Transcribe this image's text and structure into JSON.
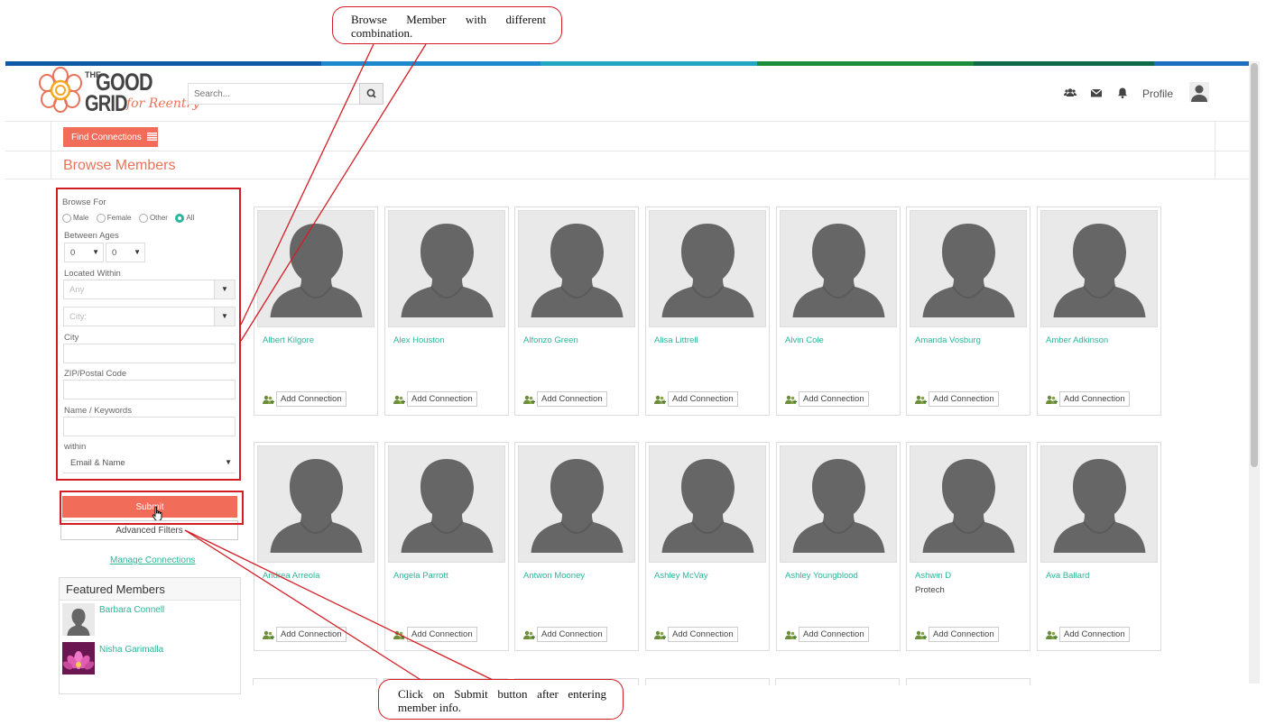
{
  "colors": {
    "accent": "#f26c5a",
    "link": "#2bb59a",
    "annotation": "#d31d25",
    "stripe": [
      "#0f5aa7",
      "#1e88cf",
      "#20a7c1",
      "#1a8d3b",
      "#0f6a4a",
      "#1e6fbf"
    ]
  },
  "header": {
    "logo": {
      "the": "THE",
      "good": "GOOD",
      "grid": "GRID",
      "tagline": "for Reentry"
    },
    "search_placeholder": "Search...",
    "icons": [
      "users-icon",
      "envelope-icon",
      "bell-icon"
    ],
    "profile_label": "Profile"
  },
  "toolbar": {
    "find_connections": "Find Connections"
  },
  "page_title": "Browse Members",
  "filters": {
    "browse_for_label": "Browse For",
    "gender_options": [
      {
        "label": "Male",
        "selected": false
      },
      {
        "label": "Female",
        "selected": false
      },
      {
        "label": "Other",
        "selected": false
      },
      {
        "label": "All",
        "selected": true
      }
    ],
    "between_ages_label": "Between Ages",
    "age_min": "0",
    "age_max": "0",
    "located_within_label": "Located Within",
    "located_value": "Any",
    "city_select_placeholder": "City:",
    "city_label": "City",
    "zip_label": "ZIP/Postal Code",
    "name_keywords_label": "Name / Keywords",
    "within_label": "within",
    "within_value": "Email & Name",
    "submit_label": "Submit",
    "advanced_label": "Advanced Filters",
    "manage_label": "Manage Connections"
  },
  "featured": {
    "title": "Featured Members",
    "members": [
      {
        "name": "Barbara Connell",
        "photo": "silhouette"
      },
      {
        "name": "Nisha Garimalla",
        "photo": "lotus-flower"
      }
    ]
  },
  "members": [
    {
      "name": "Albert Kilgore",
      "subtitle": ""
    },
    {
      "name": "Alex Houston",
      "subtitle": ""
    },
    {
      "name": "Alfonzo Green",
      "subtitle": ""
    },
    {
      "name": "Alisa Littrell",
      "subtitle": ""
    },
    {
      "name": "Alvin Cole",
      "subtitle": ""
    },
    {
      "name": "Amanda Vosburg",
      "subtitle": ""
    },
    {
      "name": "Amber Adkinson",
      "subtitle": ""
    },
    {
      "name": "Andrea Arreola",
      "subtitle": ""
    },
    {
      "name": "Angela Parrott",
      "subtitle": ""
    },
    {
      "name": "Antwon Mooney",
      "subtitle": ""
    },
    {
      "name": "Ashley McVay",
      "subtitle": ""
    },
    {
      "name": "Ashley Youngblood",
      "subtitle": ""
    },
    {
      "name": "Ashwin D",
      "subtitle": "Protech"
    },
    {
      "name": "Ava Ballard",
      "subtitle": ""
    }
  ],
  "add_connection_label": "Add Connection",
  "annotations": {
    "top": "Browse Member with different combination.",
    "bottom": "Click on Submit button after entering member info."
  }
}
